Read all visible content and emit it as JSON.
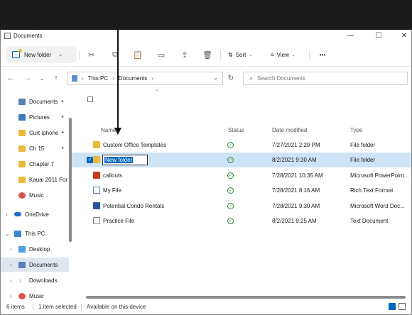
{
  "window": {
    "title": "Documents"
  },
  "window_controls": {
    "minimize": "—",
    "maximize": "☐",
    "close": "✕"
  },
  "toolbar": {
    "new_label": "New folder",
    "sort_label": "Sort",
    "view_label": "View",
    "more_label": "•••"
  },
  "address": {
    "crumbs": [
      "This PC",
      "Documents"
    ],
    "separator": "›",
    "search_placeholder": "Search Documents"
  },
  "sidebar": {
    "items": [
      {
        "label": "Documents",
        "pinned": true
      },
      {
        "label": "Pictures",
        "pinned": true
      },
      {
        "label": "Curt iphone",
        "pinned": true
      },
      {
        "label": "Ch 15",
        "pinned": true
      },
      {
        "label": "Chapter 7",
        "pinned": false
      },
      {
        "label": "Kauai 2011 For",
        "pinned": false
      },
      {
        "label": "Music",
        "pinned": false
      },
      {
        "label": "OneDrive",
        "pinned": false
      },
      {
        "label": "This PC",
        "pinned": false
      },
      {
        "label": "Desktop",
        "pinned": false
      },
      {
        "label": "Documents",
        "pinned": false
      },
      {
        "label": "Downloads",
        "pinned": false
      },
      {
        "label": "Music",
        "pinned": false
      }
    ]
  },
  "columns": {
    "name": "Name",
    "status": "Status",
    "date": "Date modified",
    "type": "Type"
  },
  "files": [
    {
      "name": "Custom Office Templates",
      "date": "7/27/2021 2:29 PM",
      "type": "File folder",
      "icon": "folder-icon"
    },
    {
      "name": "New folder",
      "date": "8/2/2021 9:30 AM",
      "type": "File folder",
      "icon": "folder-icon",
      "renaming": true
    },
    {
      "name": "callouts",
      "date": "7/28/2021 10:35 AM",
      "type": "Microsoft PowerPoint...",
      "icon": "powerpoint-icon"
    },
    {
      "name": "My File",
      "date": "7/28/2021 8:16 AM",
      "type": "Rich Text Format",
      "icon": "rtf-icon"
    },
    {
      "name": "Potential Condo Rentals",
      "date": "7/28/2021 9:30 AM",
      "type": "Microsoft Word Doc...",
      "icon": "word-icon"
    },
    {
      "name": "Practice File",
      "date": "8/2/2021 9:25 AM",
      "type": "Text Document",
      "icon": "text-file-icon"
    }
  ],
  "statusbar": {
    "items_count": "6 items",
    "selected": "1 item selected",
    "availability": "Available on this device"
  }
}
